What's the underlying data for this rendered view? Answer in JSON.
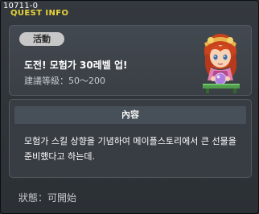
{
  "quest_id": "10711-0",
  "window": {
    "title": "QUEST INFO"
  },
  "quest": {
    "category": "活動",
    "title": "도전! 모험가 30레벨 업!",
    "level_range": "建議等級：50～200"
  },
  "content": {
    "header": "內容",
    "description": "모험가 스킬 상향을 기념하여 메이플스토리에서 큰 선물을 준비했다고 하는데."
  },
  "status": "狀態：可開始"
}
